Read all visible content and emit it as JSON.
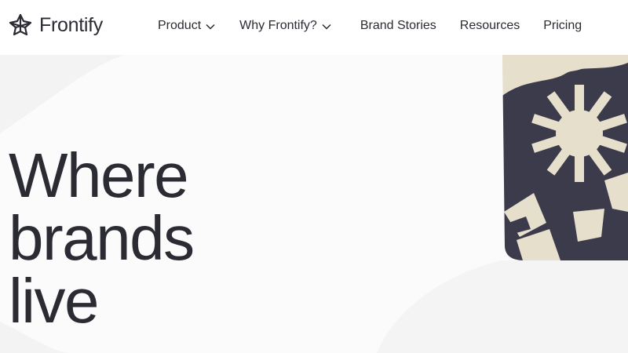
{
  "brand": {
    "name": "Frontify",
    "logo_icon": "frontify-logo-icon"
  },
  "nav": {
    "items": [
      {
        "label": "Product",
        "has_dropdown": true
      },
      {
        "label": "Why Frontify?",
        "has_dropdown": true
      },
      {
        "label": "Brand Stories",
        "has_dropdown": false
      },
      {
        "label": "Resources",
        "has_dropdown": false
      },
      {
        "label": "Pricing",
        "has_dropdown": false
      }
    ]
  },
  "hero": {
    "title_lines": [
      "Where",
      "brands",
      "live"
    ],
    "art_icon": "brand-pattern-illustration"
  },
  "colors": {
    "text": "#2b2b33",
    "art_dark": "#3b3b4c",
    "art_light": "#e6dfcc",
    "background": "#ffffff",
    "hero_background": "#fbfbfb"
  }
}
